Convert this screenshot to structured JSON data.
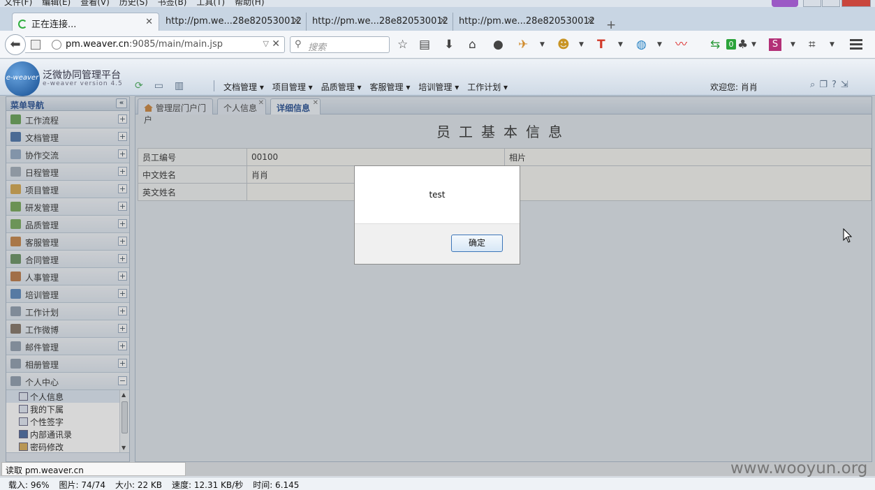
{
  "browser": {
    "menu": [
      "文件(F)",
      "编辑(E)",
      "查看(V)",
      "历史(S)",
      "书签(B)",
      "工具(T)",
      "帮助(H)"
    ],
    "tabs": [
      {
        "title": "正在连接...",
        "active": true
      },
      {
        "title": "http://pm.we...28e820530012"
      },
      {
        "title": "http://pm.we...28e820530012"
      },
      {
        "title": "http://pm.we...28e820530012"
      }
    ],
    "url_host": "pm.weaver.cn",
    "url_rest": ":9085/main/main.jsp",
    "search_placeholder": "搜索",
    "badge_count": "0"
  },
  "app": {
    "logo_text": "e-weaver",
    "title": "泛微协同管理平台",
    "version": "e-weaver version 4.5",
    "top_menu": [
      "文档管理 ▾",
      "项目管理 ▾",
      "品质管理 ▾",
      "客服管理 ▾",
      "培训管理 ▾",
      "工作计划 ▾"
    ],
    "welcome": "欢迎您: 肖肖"
  },
  "sidebar": {
    "title": "菜单导航",
    "items": [
      {
        "label": "工作流程",
        "color": "#5a9a48"
      },
      {
        "label": "文档管理",
        "color": "#3d6aa3"
      },
      {
        "label": "协作交流",
        "color": "#8aa3bf"
      },
      {
        "label": "日程管理",
        "color": "#9aa7b5"
      },
      {
        "label": "项目管理",
        "color": "#d0a040"
      },
      {
        "label": "研发管理",
        "color": "#6aa04a"
      },
      {
        "label": "品质管理",
        "color": "#6ba350"
      },
      {
        "label": "客服管理",
        "color": "#c07a3a"
      },
      {
        "label": "合同管理",
        "color": "#5d8a56"
      },
      {
        "label": "人事管理",
        "color": "#b5703a"
      },
      {
        "label": "培训管理",
        "color": "#4e7fb8"
      },
      {
        "label": "工作计划",
        "color": "#8796a8"
      },
      {
        "label": "工作微博",
        "color": "#7a6a5a"
      },
      {
        "label": "邮件管理",
        "color": "#8796a8"
      },
      {
        "label": "相册管理",
        "color": "#8796a8"
      }
    ],
    "expanded": {
      "label": "个人中心",
      "color": "#8796a8"
    },
    "sub_items": [
      "个人信息",
      "我的下属",
      "个性签字",
      "内部通讯录",
      "密码修改"
    ]
  },
  "content": {
    "tabs": [
      "管理层门户门户",
      "个人信息",
      "详细信息"
    ],
    "page_title": "员工基本信息",
    "rows": [
      {
        "label": "员工编号",
        "value": "00100",
        "extra": "相片"
      },
      {
        "label": "中文姓名",
        "value": "肖肖",
        "extra": ""
      },
      {
        "label": "英文姓名",
        "value": "",
        "extra": ""
      }
    ]
  },
  "dialog": {
    "message": "test",
    "ok_label": "确定"
  },
  "status": {
    "popup": "读取 pm.weaver.cn",
    "load": "载入: 96%",
    "images": "图片: 74/74",
    "size": "大小: 22 KB",
    "speed": "速度: 12.31 KB/秒",
    "time": "时间: 6.145"
  },
  "watermark": "www.wooyun.org"
}
